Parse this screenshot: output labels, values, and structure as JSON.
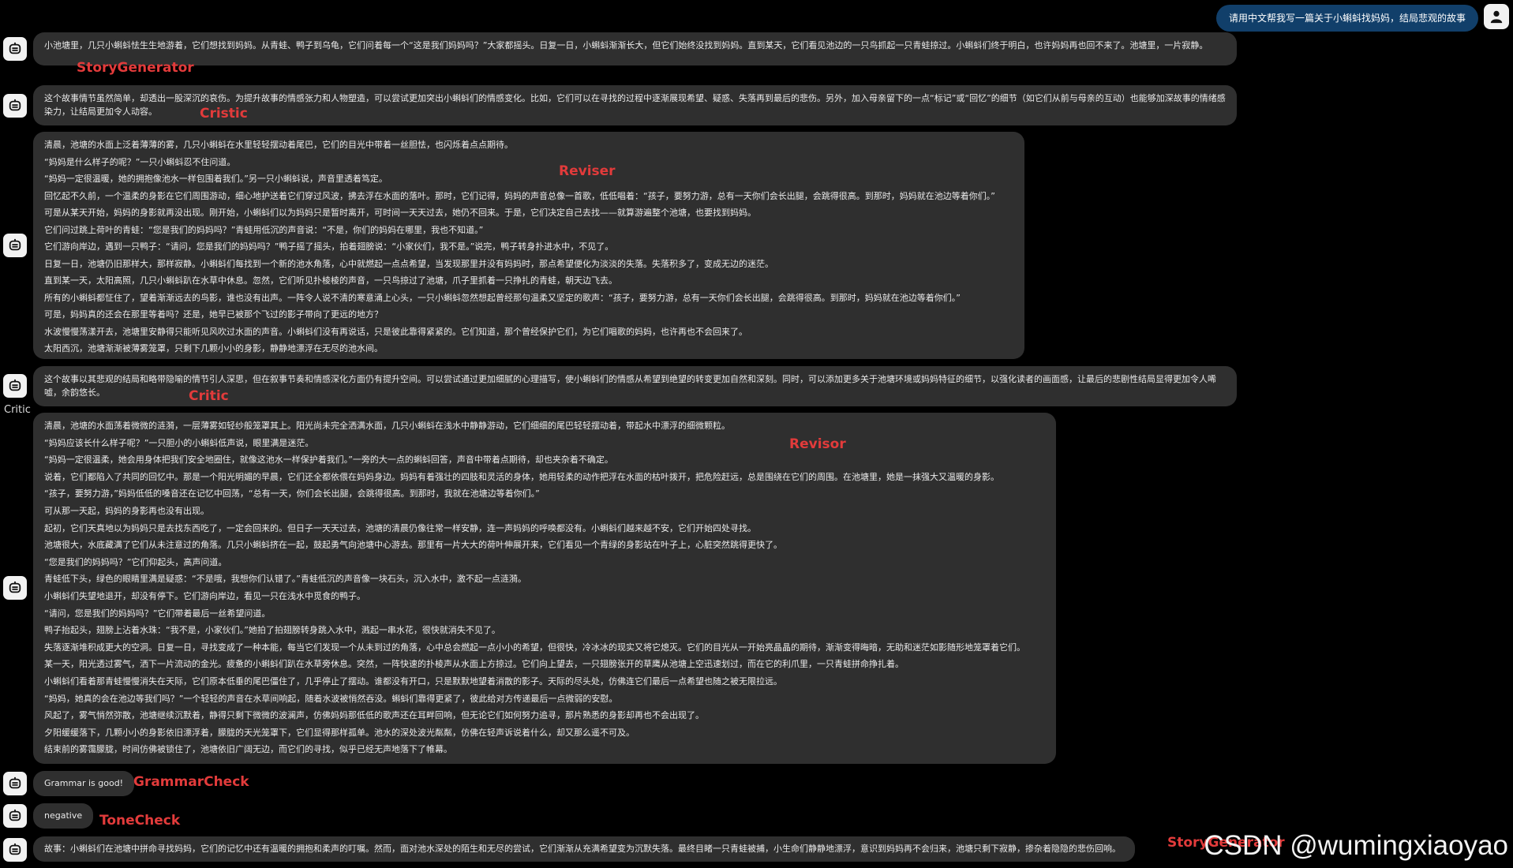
{
  "user_prompt": "请用中文帮我写一篇关于小蝌蚪找妈妈，结局悲观的故事",
  "icons": {
    "user": "user-icon",
    "bot": "robot-icon"
  },
  "colors": {
    "background": "#000000",
    "bubble": "#2f2f2f",
    "user_bubble": "#113f6a",
    "agent_label": "#e23b3b"
  },
  "messages": {
    "m1": {
      "agent": "StoryGenerator",
      "lines": [
        "小池塘里，几只小蝌蚪怯生生地游着，它们想找到妈妈。从青蛙、鸭子到乌龟，它们问着每一个“这是我们妈妈吗？”大家都摇头。日复一日，小蝌蚪渐渐长大，但它们始终没找到妈妈。直到某天，它们看见池边的一只鸟抓起一只青蛙掠过。小蝌蚪们终于明白，也许妈妈再也回不来了。池塘里，一片寂静。"
      ]
    },
    "m2": {
      "agent": "Cristic",
      "lines": [
        "这个故事情节虽然简单，却透出一股深沉的哀伤。为提升故事的情感张力和人物塑造，可以尝试更加突出小蝌蚪们的情感变化。比如，它们可以在寻找的过程中逐渐展现希望、疑惑、失落再到最后的悲伤。另外，加入母亲留下的一点“标记”或“回忆”的细节（如它们从前与母亲的互动）也能够加深故事的情绪感染力，让结局更加令人动容。"
      ]
    },
    "m3": {
      "agent": "Reviser",
      "lines": [
        "清晨，池塘的水面上泛着薄薄的雾，几只小蝌蚪在水里轻轻摆动着尾巴，它们的目光中带着一丝胆怯，也闪烁着点点期待。",
        "“妈妈是什么样子的呢？”一只小蝌蚪忍不住问道。",
        "“妈妈一定很温暖，她的拥抱像池水一样包围着我们。”另一只小蝌蚪说，声音里透着笃定。",
        "回忆起不久前，一个温柔的身影在它们周围游动，细心地护送着它们穿过风波，拂去浮在水面的落叶。那时，它们记得，妈妈的声音总像一首歌，低低唱着：“孩子，要努力游，总有一天你们会长出腿，会跳得很高。到那时，妈妈就在池边等着你们。”",
        "可是从某天开始，妈妈的身影就再没出现。刚开始，小蝌蚪们以为妈妈只是暂时离开，可时间一天天过去，她仍不回来。于是，它们决定自己去找——就算游遍整个池塘，也要找到妈妈。",
        "它们问过跳上荷叶的青蛙：“您是我们的妈妈吗？”青蛙用低沉的声音说：“不是，你们的妈妈在哪里，我也不知道。”",
        "它们游向岸边，遇到一只鸭子：“请问，您是我们的妈妈吗？”鸭子摇了摇头，拍着翅膀说：“小家伙们，我不是。”说完，鸭子转身扑进水中，不见了。",
        "日复一日，池塘仍旧那样大，那样寂静。小蝌蚪们每找到一个新的池水角落，心中就燃起一点点希望，当发现那里并没有妈妈时，那点希望便化为淡淡的失落。失落积多了，变成无边的迷茫。",
        "直到某一天，太阳高照，几只小蝌蚪趴在水草中休息。忽然，它们听见扑棱棱的声音，一只鸟掠过了池塘，爪子里抓着一只挣扎的青蛙，朝天边飞去。",
        "所有的小蝌蚪都怔住了，望着渐渐远去的鸟影，谁也没有出声。一阵令人说不清的寒意涌上心头，一只小蝌蚪忽然想起曾经那句温柔又坚定的歌声：“孩子，要努力游，总有一天你们会长出腿，会跳得很高。到那时，妈妈就在池边等着你们。”",
        "可是，妈妈真的还会在那里等着吗？还是，她早已被那个飞过的影子带向了更远的地方？",
        "水波慢慢荡漾开去，池塘里安静得只能听见风吹过水面的声音。小蝌蚪们没有再说话，只是彼此靠得紧紧的。它们知道，那个曾经保护它们，为它们唱歌的妈妈，也许再也不会回来了。",
        "太阳西沉，池塘渐渐被薄雾笼罩，只剩下几颗小小的身影，静静地漂浮在无尽的池水间。"
      ]
    },
    "m4": {
      "agent": "Critic",
      "side_label": "Critic",
      "lines": [
        "这个故事以其悲观的结局和略带隐喻的情节引人深思，但在叙事节奏和情感深化方面仍有提升空间。可以尝试通过更加细腻的心理描写，使小蝌蚪们的情感从希望到绝望的转变更加自然和深刻。同时，可以添加更多关于池塘环境或妈妈特征的细节，以强化读者的画面感，让最后的悲剧性结局显得更加令人唏嘘，余韵悠长。"
      ]
    },
    "m5": {
      "agent": "Revisor",
      "lines": [
        "清晨，池塘的水面荡着微微的涟漪，一层薄雾如轻纱般笼罩其上。阳光尚未完全洒满水面，几只小蝌蚪在浅水中静静游动，它们细细的尾巴轻轻摆动着，带起水中漂浮的细微颗粒。",
        "“妈妈应该长什么样子呢？”一只胆小的小蝌蚪低声说，眼里满是迷茫。",
        "“妈妈一定很温柔，她会用身体把我们安全地圈住，就像这池水一样保护着我们。”一旁的大一点的蝌蚪回答，声音中带着点期待，却也夹杂着不确定。",
        "说着，它们都陷入了共同的回忆中。那是一个阳光明媚的早晨，它们还全都依偎在妈妈身边。妈妈有着强壮的四肢和灵活的身体，她用轻柔的动作把浮在水面的枯叶拨开，把危险赶远，总是围绕在它们的周围。在池塘里，她是一抹强大又温暖的身影。",
        "“孩子，要努力游，”妈妈低低的嗓音还在记忆中回荡，“总有一天，你们会长出腿，会跳得很高。到那时，我就在池塘边等着你们。”",
        "可从那一天起，妈妈的身影再也没有出现。",
        "起初，它们天真地以为妈妈只是去找东西吃了，一定会回来的。但日子一天天过去，池塘的清晨仍像往常一样安静，连一声妈妈的呼唤都没有。小蝌蚪们越来越不安，它们开始四处寻找。",
        "池塘很大，水底藏满了它们从未注意过的角落。几只小蝌蚪挤在一起，鼓起勇气向池塘中心游去。那里有一片大大的荷叶伸展开来，它们看见一个青绿的身影站在叶子上，心脏突然跳得更快了。",
        "“您是我们的妈妈吗？”它们仰起头，高声问道。",
        "青蛙低下头，绿色的眼睛里满是疑惑：“不是哦，我想你们认错了。”青蛙低沉的声音像一块石头，沉入水中，激不起一点涟漪。",
        "小蝌蚪们失望地退开，却没有停下。它们游向岸边，看见一只在浅水中觅食的鸭子。",
        "“请问，您是我们的妈妈吗？”它们带着最后一丝希望问道。",
        "鸭子抬起头，翅膀上沾着水珠：“我不是，小家伙们。”她拍了拍翅膀转身跳入水中，溅起一串水花，很快就消失不见了。",
        "失落逐渐堆积成更大的空洞。日复一日，寻找变成了一种本能，每当它们发现一个从未到过的角落，心中总会燃起一点小小的希望，但很快，冷冰冰的现实又将它熄灭。它们的目光从一开始亮晶晶的期待，渐渐变得晦暗，无助和迷茫如影随形地笼罩着它们。",
        "某一天，阳光透过雾气，洒下一片流动的金光。疲惫的小蝌蚪们趴在水草旁休息。突然，一阵快速的扑棱声从水面上方掠过。它们向上望去，一只翅膀张开的草鹰从池塘上空迅速划过，而在它的利爪里，一只青蛙拼命挣扎着。",
        "小蝌蚪们看着那青蛙慢慢消失在天际，它们原本低垂的尾巴僵住了，几乎停止了摆动。谁都没有开口，只是默默地望着消散的影子。天际的尽头处，仿佛连它们最后一点希望也随之被无限拉远。",
        "“妈妈，她真的会在池边等我们吗？”一个轻轻的声音在水草间响起，随着水波被悄然吞没。蝌蚪们靠得更紧了，彼此给对方传递最后一点微弱的安慰。",
        "风起了，雾气悄然弥散，池塘继续沉默着，静得只剩下微微的波澜声，仿佛妈妈那低低的歌声还在耳畔回响，但无论它们如何努力追寻，那片熟悉的身影却再也不会出现了。",
        "夕阳缓缓落下，几颗小小的身影依旧漂浮着，朦胧的天光笼罩下，它们显得那样孤单。池水的深处波光粼粼，仿佛在轻声诉说着什么，却又那么遥不可及。",
        "结束前的雾霭朦胧，时间仿佛被锁住了，池塘依旧广阔无边，而它们的寻找，似乎已经无声地落下了帷幕。"
      ]
    },
    "m6": {
      "agent": "GrammarCheck",
      "text": "Grammar is good!"
    },
    "m7": {
      "agent": "ToneCheck",
      "text": "negative"
    },
    "m8": {
      "agent": "StoryGenerator",
      "text": "故事：小蝌蚪们在池塘中拼命寻找妈妈，它们的记忆中还有温暖的拥抱和柔声的叮嘱。然而，面对池水深处的陌生和无尽的尝试，它们渐渐从充满希望变为沉默失落。最终目睹一只青蛙被捕，小生命们静静地漂浮，意识到妈妈再不会归来，池塘只剩下寂静，掺杂着隐隐的悲伤回响。"
    }
  },
  "watermark": "CSDN @wumingxiaoyao"
}
